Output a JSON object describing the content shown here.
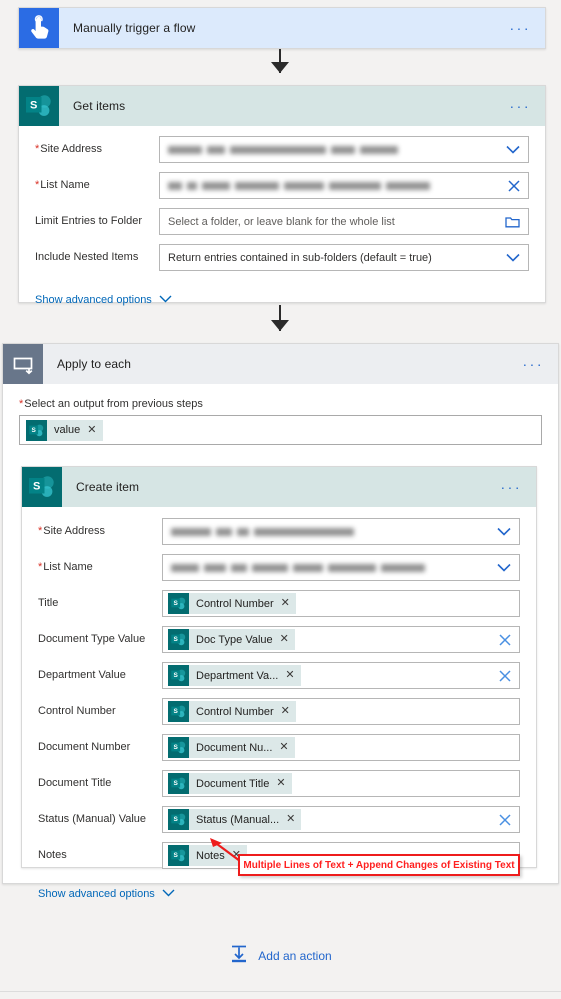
{
  "flow": {
    "trigger": {
      "title": "Manually trigger a flow",
      "icon": "touch-trigger-icon",
      "menu": "···",
      "header_color": "#dceafc",
      "icon_color": "#2b6ce4"
    },
    "get_items": {
      "title": "Get items",
      "icon": "sharepoint-icon",
      "menu": "···",
      "header_color": "#d6e5e4",
      "icon_color": "#036c70",
      "fields": [
        {
          "label": "Site Address",
          "required": true,
          "value_type": "redacted",
          "control": "dropdown"
        },
        {
          "label": "List Name",
          "required": true,
          "value_type": "redacted",
          "control": "clear"
        },
        {
          "label": "Limit Entries to Folder",
          "required": false,
          "placeholder": "Select a folder, or leave blank for the whole list",
          "control": "folder"
        },
        {
          "label": "Include Nested Items",
          "required": false,
          "value": "Return entries contained in sub-folders (default = true)",
          "control": "dropdown"
        }
      ],
      "advanced_label": "Show advanced options"
    },
    "apply_to_each": {
      "title": "Apply to each",
      "icon": "loop-icon",
      "menu": "···",
      "header_color": "#eceef1",
      "icon_color": "#68768a",
      "input_label": "Select an output from previous steps",
      "input_required": true,
      "input_token": {
        "text": "value",
        "remove": "✕"
      }
    },
    "create_item": {
      "title": "Create item",
      "icon": "sharepoint-icon",
      "menu": "···",
      "header_color": "#d6e5e4",
      "icon_color": "#036c70",
      "advanced_label": "Show advanced options",
      "fields": [
        {
          "label": "Site Address",
          "required": true,
          "value_type": "redacted",
          "control": "dropdown"
        },
        {
          "label": "List Name",
          "required": true,
          "value_type": "redacted",
          "control": "dropdown"
        },
        {
          "label": "Title",
          "required": false,
          "token": "Control Number",
          "control": "none"
        },
        {
          "label": "Document Type Value",
          "required": false,
          "token": "Doc Type Value",
          "control": "clear"
        },
        {
          "label": "Department Value",
          "required": false,
          "token": "Department Va...",
          "control": "clear"
        },
        {
          "label": "Control Number",
          "required": false,
          "token": "Control Number",
          "control": "none"
        },
        {
          "label": "Document Number",
          "required": false,
          "token": "Document Nu...",
          "control": "none"
        },
        {
          "label": "Document Title",
          "required": false,
          "token": "Document Title",
          "control": "none"
        },
        {
          "label": "Status (Manual) Value",
          "required": false,
          "token": "Status (Manual...",
          "control": "clear"
        },
        {
          "label": "Notes",
          "required": false,
          "token": "Notes",
          "control": "none"
        }
      ]
    },
    "annotation": {
      "text": "Multiple Lines of Text + Append Changes of Existing Text",
      "color": "#ff2020",
      "border_color": "#ee1c1c"
    },
    "footer": {
      "add_action_label": "Add an action",
      "add_action_icon": "insert-action-icon",
      "link_color": "#2266cc"
    },
    "token_remove_glyph": "✕"
  }
}
